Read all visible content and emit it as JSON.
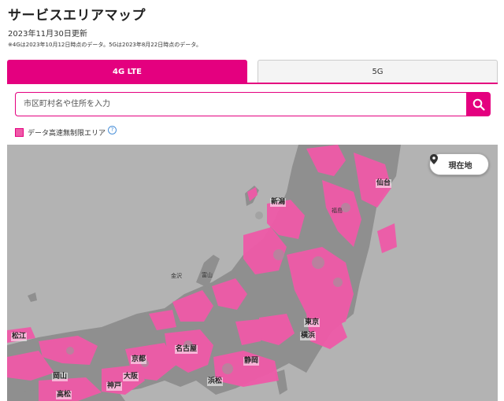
{
  "header": {
    "title": "サービスエリアマップ",
    "updated": "2023年11月30日更新",
    "note": "※4Gは2023年10月12日時点のデータ。5Gは2023年8月22日時点のデータ。"
  },
  "tabs": [
    {
      "label": "4G LTE",
      "active": true
    },
    {
      "label": "5G",
      "active": false
    }
  ],
  "search": {
    "placeholder": "市区町村名や住所を入力",
    "value": ""
  },
  "legend": {
    "label": "データ高速無制限エリア",
    "color": "#ef5aa8"
  },
  "map": {
    "locate_label": "現在地",
    "cities": {
      "sendai": "仙台",
      "niigata": "新潟",
      "fukushima": "福島",
      "kanazawa": "金沢",
      "toyama": "富山",
      "tokyo": "東京",
      "yokohama": "横浜",
      "nagoya": "名古屋",
      "kyoto": "京都",
      "osaka": "大阪",
      "kobe": "神戸",
      "shizuoka": "静岡",
      "hamamatsu": "浜松",
      "okayama": "岡山",
      "matsue": "松江",
      "takamatsu": "高松"
    }
  },
  "colors": {
    "accent": "#e4007f",
    "coverage": "#ef5aa8",
    "map_land": "#b9b9b9"
  }
}
